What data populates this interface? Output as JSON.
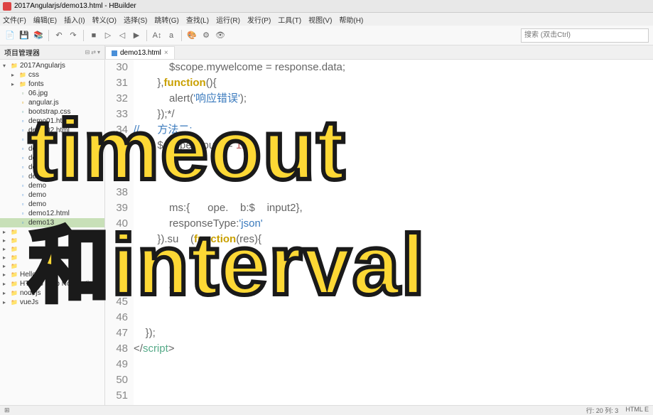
{
  "title": "2017Angularjs/demo13.html - HBuilder",
  "menu": [
    "文件(F)",
    "编辑(E)",
    "插入(I)",
    "转义(O)",
    "选择(S)",
    "跳转(G)",
    "查找(L)",
    "运行(R)",
    "发行(P)",
    "工具(T)",
    "视图(V)",
    "帮助(H)"
  ],
  "search_placeholder": "搜索 (双击Ctrl)",
  "sidebar": {
    "title": "项目管理器",
    "items": [
      {
        "d": 0,
        "tw": "▾",
        "ico": "folder",
        "label": "2017Angularjs",
        "sel": false
      },
      {
        "d": 1,
        "tw": "▸",
        "ico": "folder",
        "label": "css",
        "sel": false
      },
      {
        "d": 1,
        "tw": "▸",
        "ico": "folder",
        "label": "fonts",
        "sel": false
      },
      {
        "d": 1,
        "tw": "",
        "ico": "img",
        "label": "06.jpg",
        "sel": false
      },
      {
        "d": 1,
        "tw": "",
        "ico": "js",
        "label": "angular.js",
        "sel": false
      },
      {
        "d": 1,
        "tw": "",
        "ico": "css",
        "label": "bootstrap.css",
        "sel": false
      },
      {
        "d": 1,
        "tw": "",
        "ico": "file",
        "label": "demo01.html",
        "sel": false
      },
      {
        "d": 1,
        "tw": "",
        "ico": "file",
        "label": "demo02.html",
        "sel": false
      },
      {
        "d": 1,
        "tw": "",
        "ico": "file",
        "label": "demo",
        "sel": false
      },
      {
        "d": 1,
        "tw": "",
        "ico": "file",
        "label": "demo",
        "sel": false
      },
      {
        "d": 1,
        "tw": "",
        "ico": "file",
        "label": "demo",
        "sel": false
      },
      {
        "d": 1,
        "tw": "",
        "ico": "file",
        "label": "demo",
        "sel": false
      },
      {
        "d": 1,
        "tw": "",
        "ico": "file",
        "label": "demo",
        "sel": false
      },
      {
        "d": 1,
        "tw": "",
        "ico": "file",
        "label": "demo",
        "sel": false
      },
      {
        "d": 1,
        "tw": "",
        "ico": "file",
        "label": "demo",
        "sel": false
      },
      {
        "d": 1,
        "tw": "",
        "ico": "file",
        "label": "demo",
        "sel": false
      },
      {
        "d": 1,
        "tw": "",
        "ico": "file",
        "label": "demo12.html",
        "sel": false
      },
      {
        "d": 1,
        "tw": "",
        "ico": "file",
        "label": "demo13",
        "sel": true
      },
      {
        "d": 0,
        "tw": "▸",
        "ico": "folder",
        "label": "",
        "sel": false
      },
      {
        "d": 0,
        "tw": "▸",
        "ico": "folder",
        "label": "",
        "sel": false
      },
      {
        "d": 0,
        "tw": "▸",
        "ico": "folder",
        "label": "",
        "sel": false
      },
      {
        "d": 0,
        "tw": "▸",
        "ico": "folder",
        "label": "",
        "sel": false
      },
      {
        "d": 0,
        "tw": "▸",
        "ico": "folder",
        "label": "",
        "sel": false
      },
      {
        "d": 0,
        "tw": "▸",
        "ico": "folder",
        "label": "Hello",
        "sel": false
      },
      {
        "d": 0,
        "tw": "▸",
        "ico": "folder",
        "label": "HTML5 Web Notification",
        "sel": false
      },
      {
        "d": 0,
        "tw": "▸",
        "ico": "folder",
        "label": "nodejs",
        "sel": false
      },
      {
        "d": 0,
        "tw": "▸",
        "ico": "folder",
        "label": "vueJs",
        "sel": false
      }
    ]
  },
  "editor": {
    "tab": "demo13.html",
    "lines": [
      {
        "n": 30,
        "html": "            $scope.mywelcome = response.data;"
      },
      {
        "n": 31,
        "html": "        },<span class='fn'>function</span>(){"
      },
      {
        "n": 32,
        "html": "            alert(<span class='str'>'响应错误'</span>);"
      },
      {
        "n": 33,
        "html": "        });*/"
      },
      {
        "n": 34,
        "html": "<span class='com'>//      方法二:</span>"
      },
      {
        "n": 35,
        "html": "        $scope.input1 = <span class='num'>12</span>;"
      },
      {
        "n": 36,
        "html": ""
      },
      {
        "n": 37,
        "html": ""
      },
      {
        "n": 38,
        "html": ""
      },
      {
        "n": 39,
        "html": "            ms:{      ope.    b:$    input2},"
      },
      {
        "n": 40,
        "html": "            responseType:<span class='str'>'json'</span>"
      },
      {
        "n": 41,
        "html": "        }).su    (<span class='fn'>function</span>(res){"
      },
      {
        "n": 42,
        "html": ""
      },
      {
        "n": 43,
        "html": ""
      },
      {
        "n": 44,
        "html": "            a"
      },
      {
        "n": 45,
        "html": ""
      },
      {
        "n": 46,
        "html": ""
      },
      {
        "n": 47,
        "html": "    });"
      },
      {
        "n": 48,
        "html": "&lt;/<span class='tag'>script</span>&gt;"
      },
      {
        "n": 49,
        "html": ""
      },
      {
        "n": 50,
        "html": ""
      },
      {
        "n": 51,
        "html": ""
      }
    ]
  },
  "status": {
    "pos": "行: 20 列: 3",
    "lang": "HTML E"
  },
  "overlay": {
    "line1": "timeout",
    "line2_cjk": "和",
    "line2_rest": "interval"
  }
}
